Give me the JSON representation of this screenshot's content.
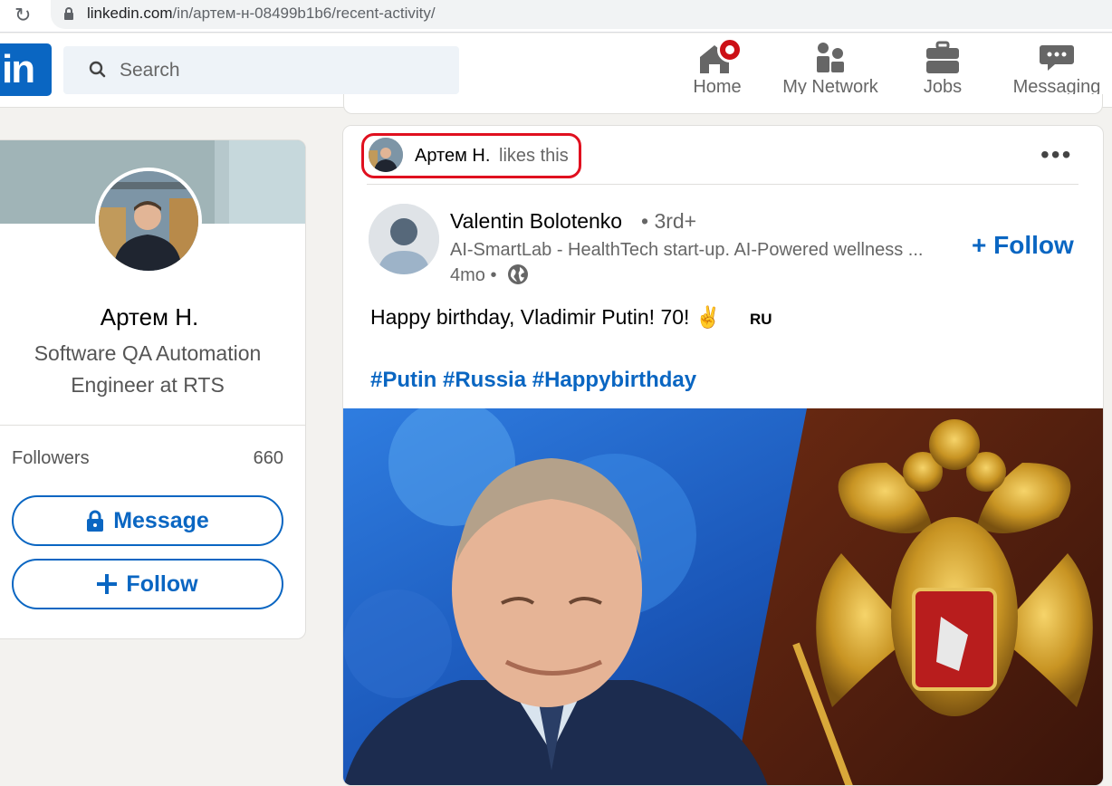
{
  "browser": {
    "url_domain": "linkedin.com",
    "url_path": "/in/артем-н-08499b1b6/recent-activity/"
  },
  "nav": {
    "logo": "in",
    "search_placeholder": "Search",
    "items": [
      {
        "label": "Home",
        "icon": "home-icon"
      },
      {
        "label": "My Network",
        "icon": "network-icon"
      },
      {
        "label": "Jobs",
        "icon": "briefcase-icon"
      },
      {
        "label": "Messaging",
        "icon": "chat-icon"
      }
    ]
  },
  "profile": {
    "name": "Артем Н.",
    "headline": "Software QA Automation Engineer at RTS",
    "followers_label": "Followers",
    "followers_count": "660",
    "message_label": "Message",
    "follow_label": "Follow"
  },
  "post": {
    "liker_name": "Артем Н.",
    "likes_text": "likes this",
    "author_name": "Valentin Bolotenko",
    "author_degree": "• 3rd+",
    "author_subtitle": "AI-SmartLab - HealthTech start-up. AI-Powered wellness ...",
    "time": "4mo •",
    "follow_label": "Follow",
    "text": "Happy birthday, Vladimir Putin! 70! ✌️",
    "lang_tag": "RU",
    "hashtags": "#Putin #Russia #Happybirthday"
  },
  "colors": {
    "brand": "#0a66c2",
    "highlight": "#e0101f",
    "notification": "#cc1016"
  }
}
